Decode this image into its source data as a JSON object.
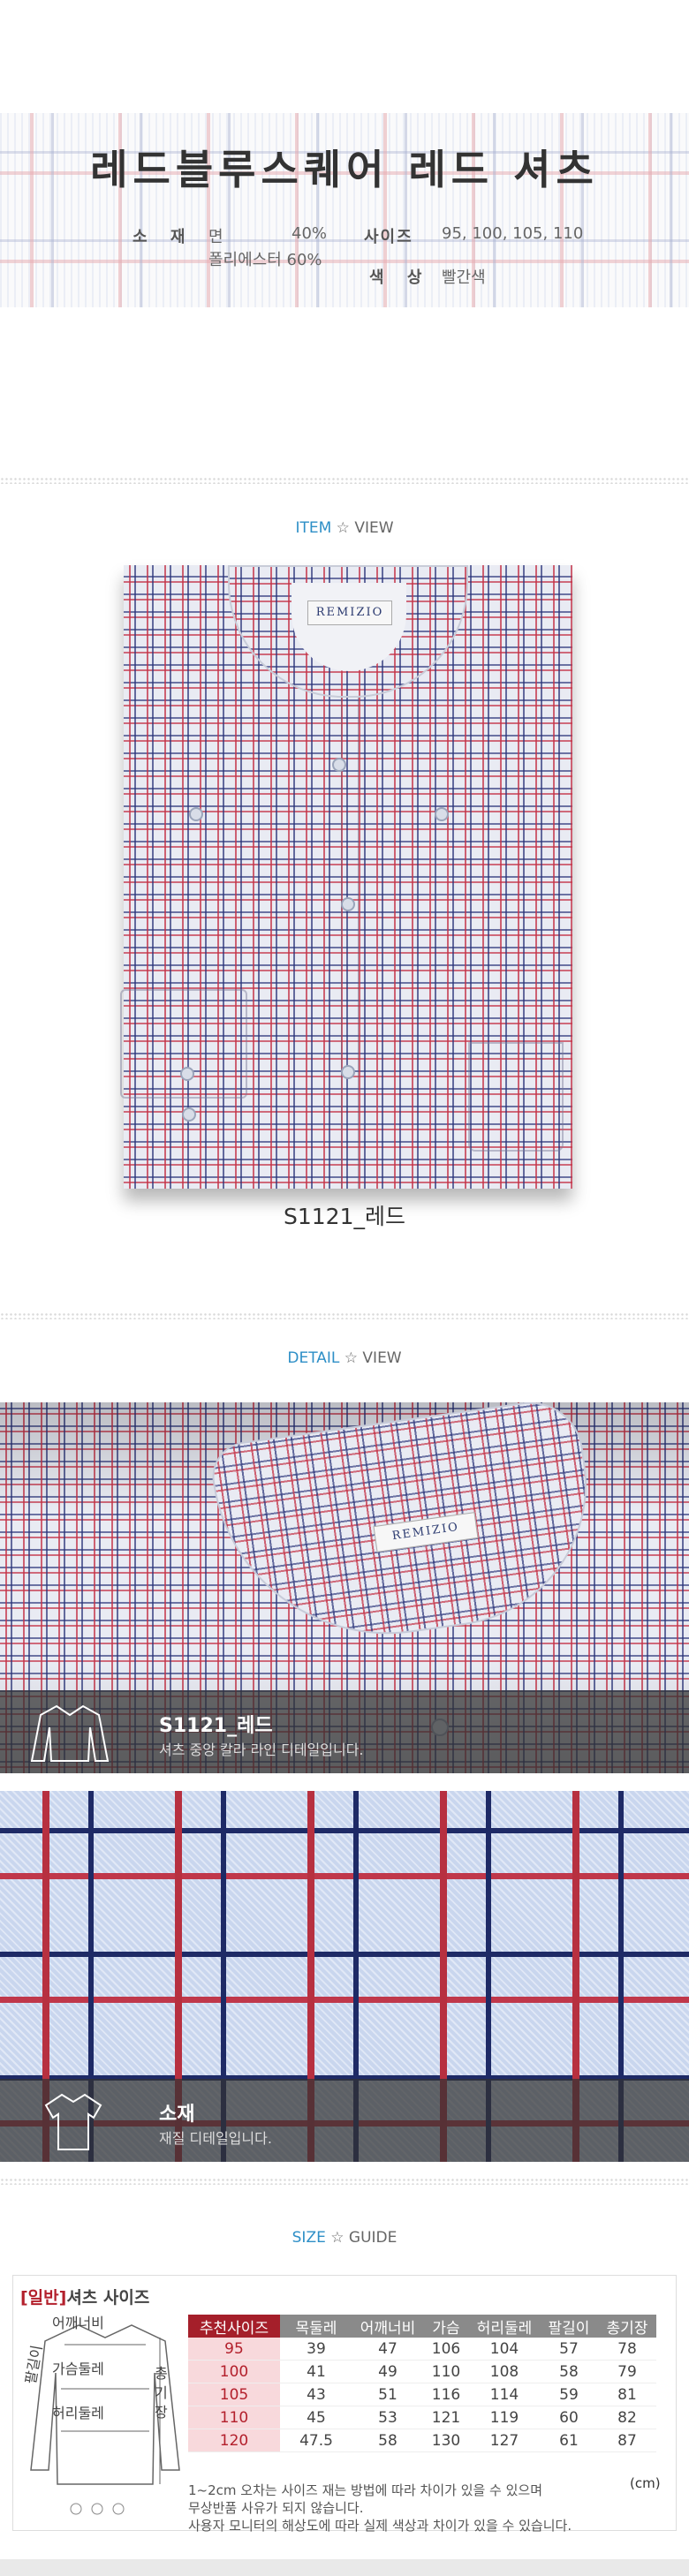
{
  "header": {
    "title": "레드블루스퀘어 레드 셔츠",
    "material_label": "소 재",
    "material_value_1_name": "면",
    "material_value_1_pct": "40%",
    "material_value_2": "폴리에스터 60%",
    "size_label": "사이즈",
    "size_value": "95, 100, 105, 110",
    "color_label": "색 상",
    "color_value": "빨간색"
  },
  "item_view": {
    "title_accent": "ITEM",
    "title_rest": " ☆ VIEW",
    "brand_label": "REMIZIO",
    "product_code": "S1121_레드"
  },
  "detail_view": {
    "title_accent": "DETAIL",
    "title_rest": " ☆ VIEW",
    "photo1_title": "S1121_레드",
    "photo1_desc": "셔츠 중앙 칼라 라인 디테일입니다.",
    "brand_label": "REMIZIO",
    "photo2_title": "소재",
    "photo2_desc": "재질 디테일입니다."
  },
  "size_guide": {
    "title_accent": "SIZE",
    "title_rest": " ☆ GUIDE",
    "heading_bracket": "[일반]",
    "heading_rest": "셔츠 사이즈",
    "diagram_labels": {
      "shoulder": "어깨너비",
      "chest": "가슴둘레",
      "waist": "허리둘레",
      "length": "총기장",
      "sleeve": "팔길이"
    },
    "columns": [
      "추천사이즈",
      "목둘레",
      "어깨너비",
      "가슴",
      "허리둘레",
      "팔길이",
      "총기장"
    ],
    "rows": [
      [
        "95",
        "39",
        "47",
        "106",
        "104",
        "57",
        "78"
      ],
      [
        "100",
        "41",
        "49",
        "110",
        "108",
        "58",
        "79"
      ],
      [
        "105",
        "43",
        "51",
        "116",
        "114",
        "59",
        "81"
      ],
      [
        "110",
        "45",
        "53",
        "121",
        "119",
        "60",
        "82"
      ],
      [
        "120",
        "47.5",
        "58",
        "130",
        "127",
        "61",
        "87"
      ]
    ],
    "unit": "(cm)",
    "notes": [
      "1~2cm 오차는 사이즈 재는 방법에 따라 차이가 있을 수 있으며",
      "무상반품 사유가 되지 않습니다.",
      "사용자 모니터의 해상도에 따라 실제 색상과 차이가 있을 수 있습니다."
    ]
  },
  "colors": {
    "accent_blue": "#2e8fc7",
    "accent_red": "#a51f2a"
  }
}
